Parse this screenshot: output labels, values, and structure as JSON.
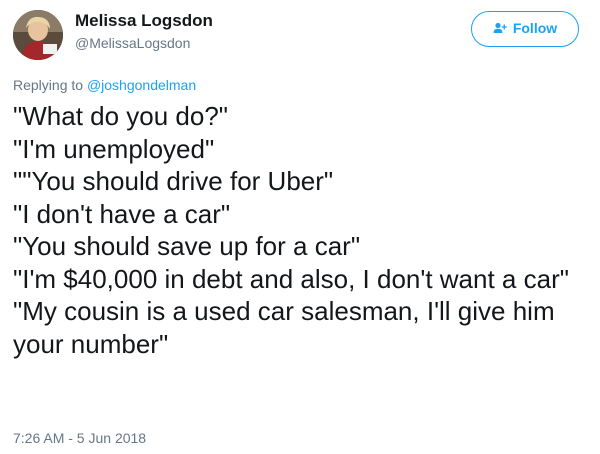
{
  "user": {
    "display_name": "Melissa Logsdon",
    "handle": "@MelissaLogsdon"
  },
  "follow_button": {
    "label": "Follow"
  },
  "reply": {
    "prefix": "Replying to ",
    "target": "@joshgondelman"
  },
  "tweet": {
    "lines": [
      "\"What do you do?\"",
      "\"I'm unemployed\"",
      "\"\"You should drive for Uber\"",
      "\"I don't have a car\"",
      "\"You should save up for a car\"",
      "\"I'm $40,000 in debt and also, I don't want a car\"",
      "\"My cousin is a used car salesman, I'll give him your number\""
    ],
    "timestamp": "7:26 AM - 5 Jun 2018"
  },
  "colors": {
    "link": "#1da1f2",
    "muted": "#657786",
    "text": "#14171a"
  },
  "icons": {
    "follow": "add-user-icon"
  }
}
